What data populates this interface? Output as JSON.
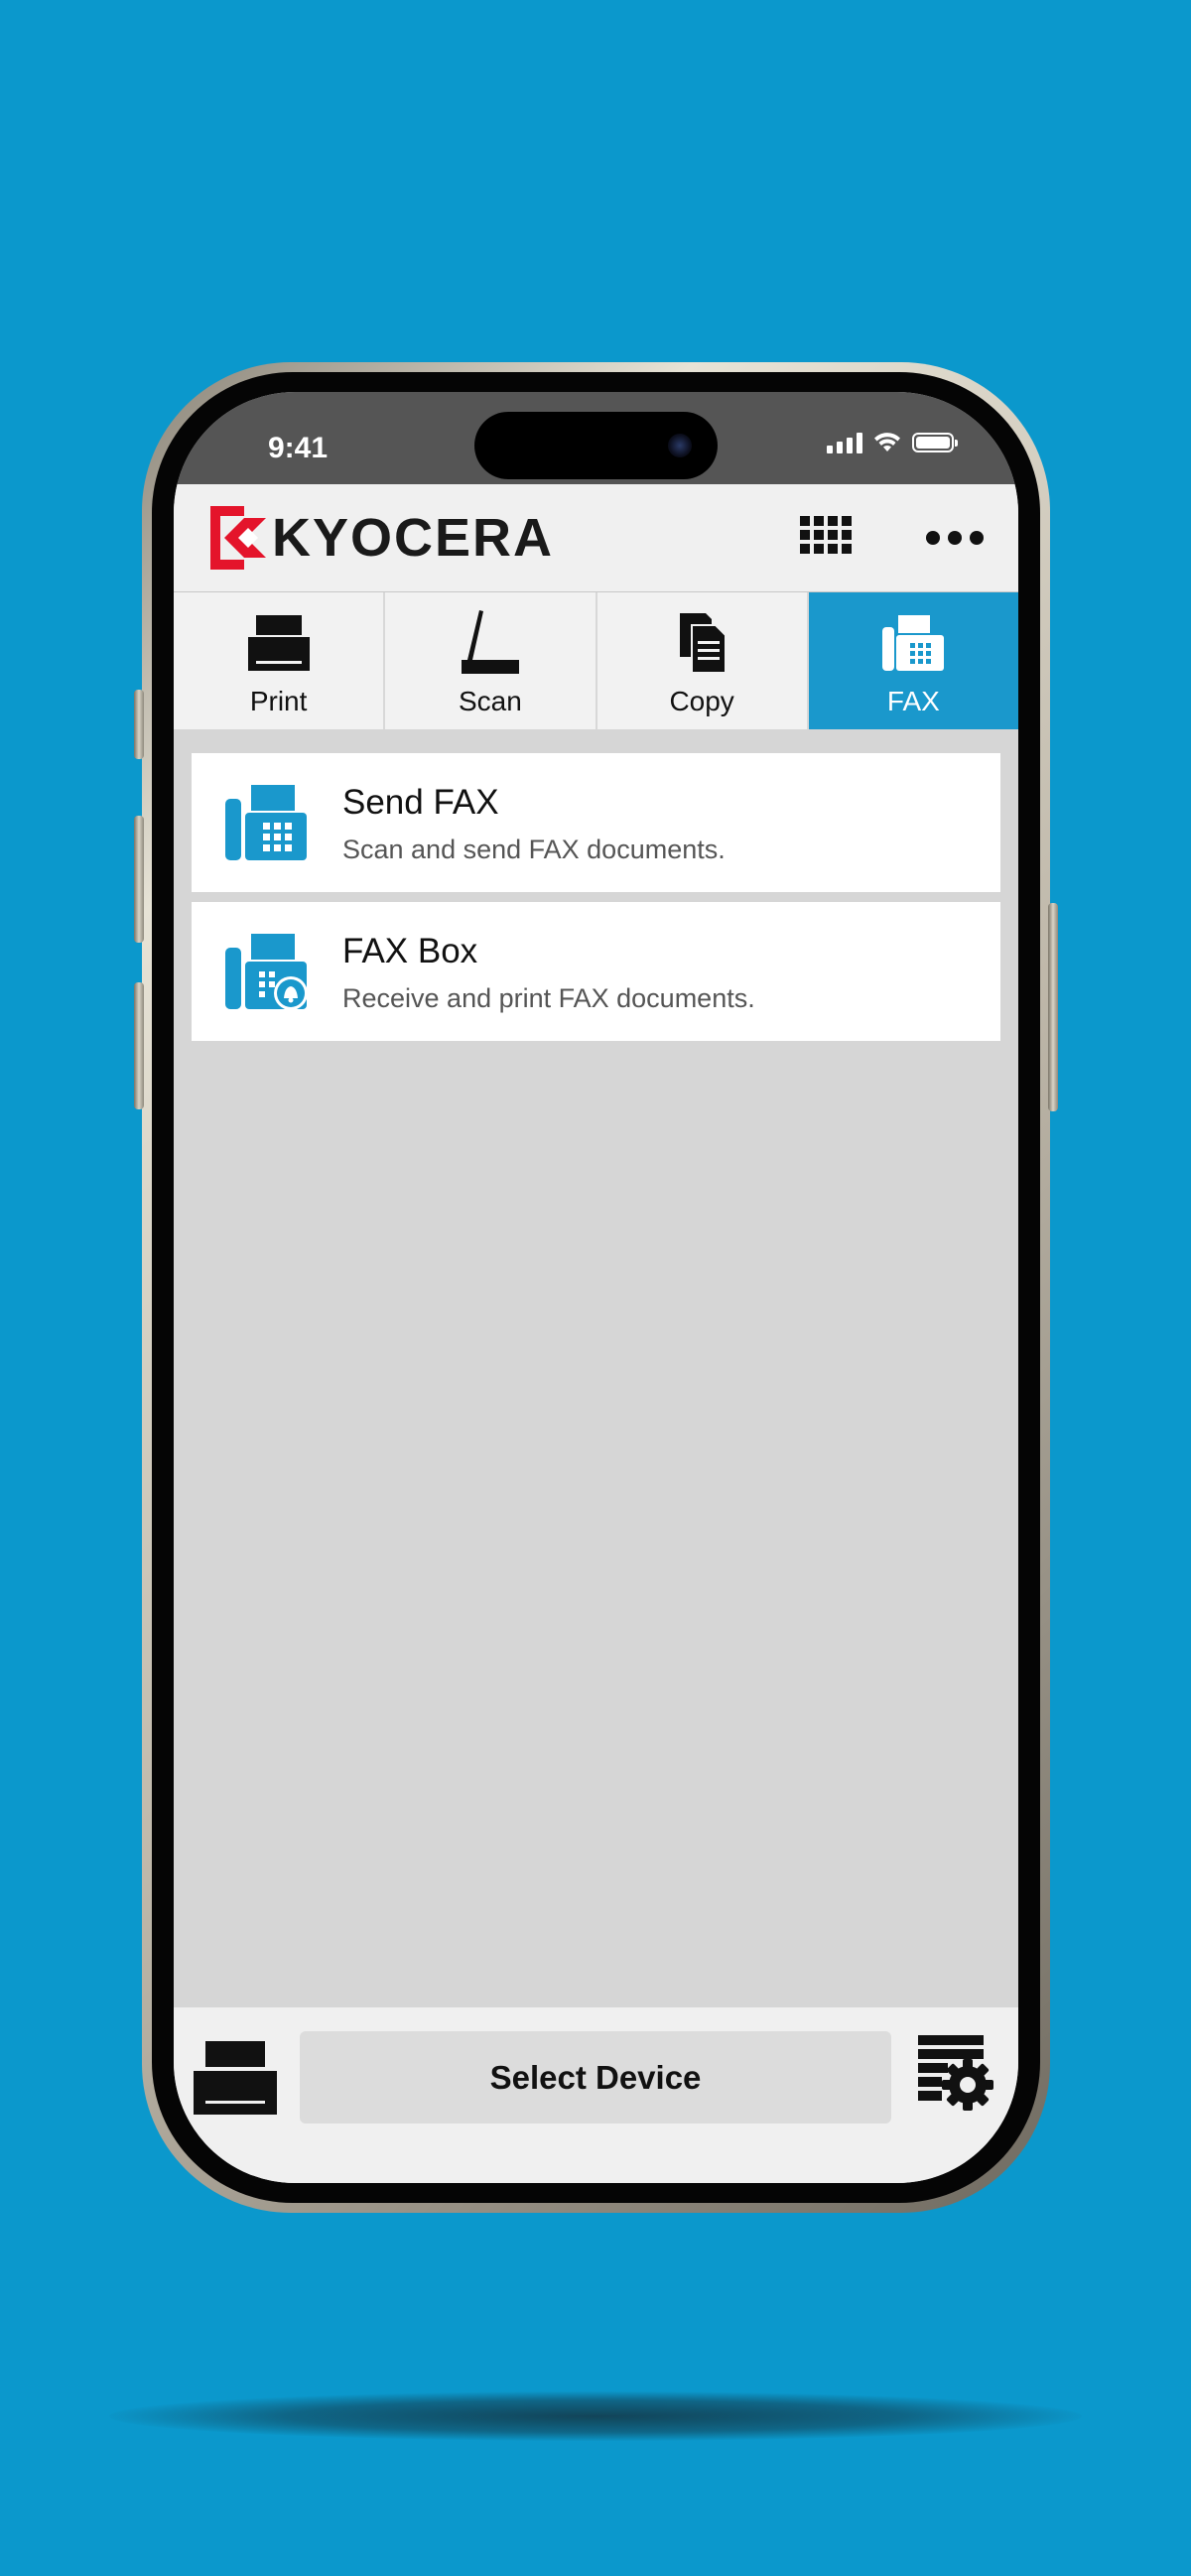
{
  "status_bar": {
    "time": "9:41"
  },
  "header": {
    "brand": "KYOCERA",
    "apps_icon": "grid-icon",
    "more_icon": "more-dots-icon"
  },
  "tabs": [
    {
      "label": "Print",
      "icon": "printer-icon",
      "active": false
    },
    {
      "label": "Scan",
      "icon": "scanner-icon",
      "active": false
    },
    {
      "label": "Copy",
      "icon": "copy-icon",
      "active": false
    },
    {
      "label": "FAX",
      "icon": "fax-icon",
      "active": true
    }
  ],
  "list": [
    {
      "title": "Send FAX",
      "subtitle": "Scan and send FAX documents.",
      "icon": "fax-icon"
    },
    {
      "title": "FAX Box",
      "subtitle": "Receive and print FAX documents.",
      "icon": "fax-box-icon"
    }
  ],
  "bottom_bar": {
    "select_device_label": "Select Device",
    "left_icon": "printer-icon",
    "right_icon": "device-settings-icon"
  },
  "colors": {
    "accent": "#1a98cc",
    "background": "#0b98cc",
    "brand_red": "#e4142b"
  }
}
